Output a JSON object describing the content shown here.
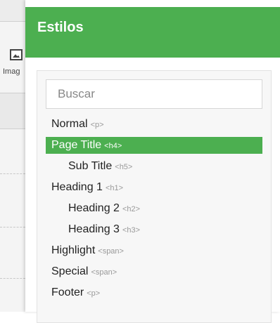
{
  "panel": {
    "title": "Estilos"
  },
  "background": {
    "image_label": "Imag"
  },
  "search": {
    "placeholder": "Buscar",
    "value": ""
  },
  "styles": [
    {
      "label": "Normal",
      "tag": "<p>"
    },
    {
      "label": "Page Title",
      "tag": "<h4>",
      "active": true
    },
    {
      "label": "Sub Title",
      "tag": "<h5>"
    },
    {
      "label": "Heading 1",
      "tag": "<h1>"
    },
    {
      "label": "Heading 2",
      "tag": "<h2>"
    },
    {
      "label": "Heading 3",
      "tag": "<h3>"
    },
    {
      "label": "Highlight",
      "tag": "<span>"
    },
    {
      "label": "Special",
      "tag": "<span>"
    },
    {
      "label": "Footer",
      "tag": "<p>"
    }
  ],
  "colors": {
    "accent": "#4caf50",
    "tag_text": "#999999"
  }
}
